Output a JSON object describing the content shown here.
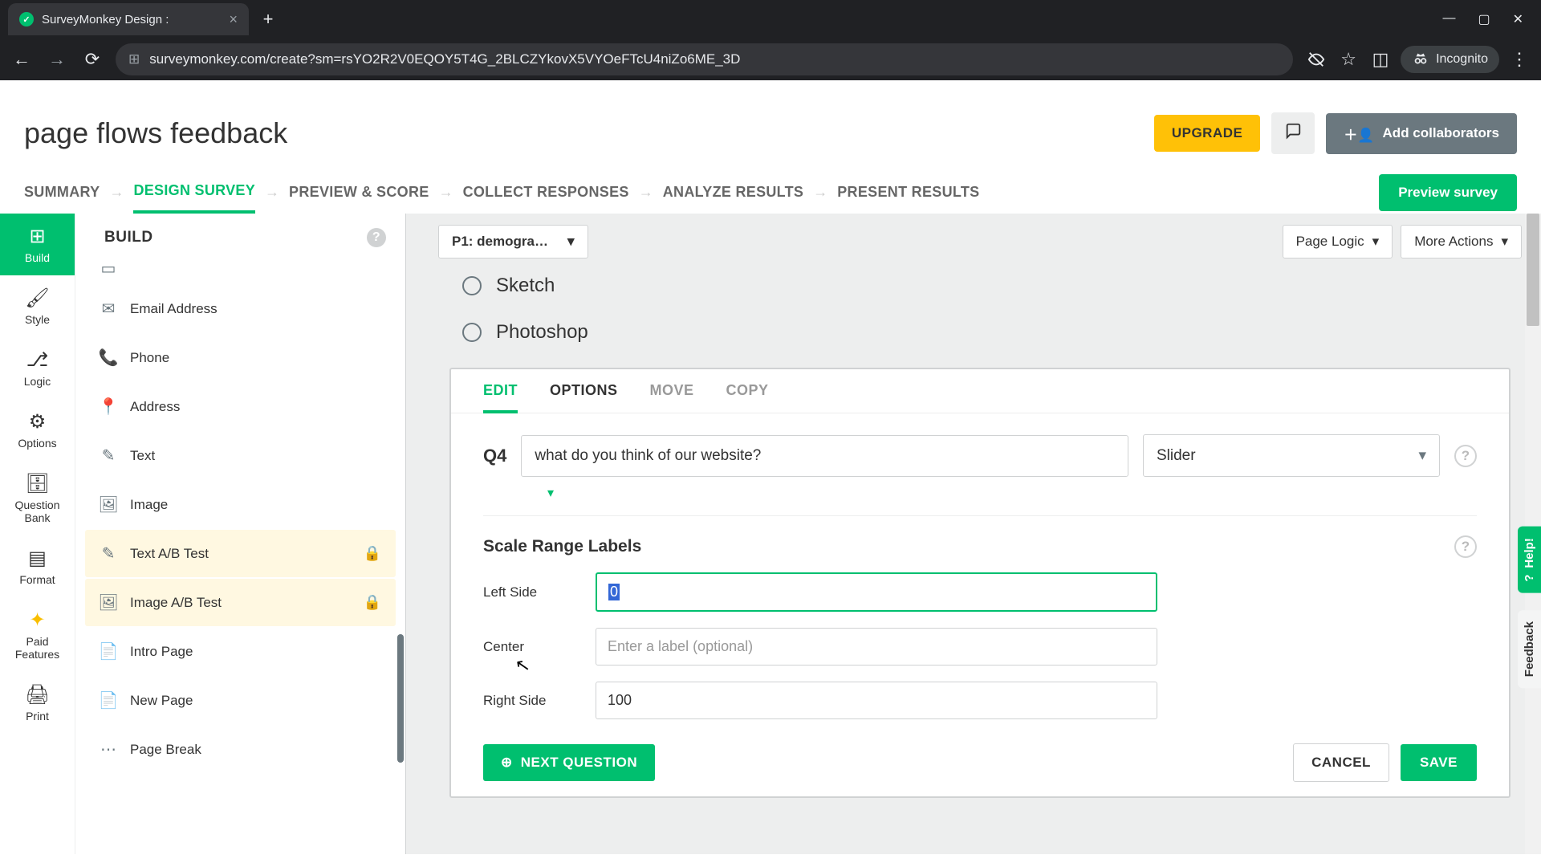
{
  "browser": {
    "tab_title": "SurveyMonkey Design :",
    "url": "surveymonkey.com/create?sm=rsYO2R2V0EQOY5T4G_2BLCZYkovX5VYOeFTcU4niZo6ME_3D",
    "incognito_label": "Incognito"
  },
  "header": {
    "survey_title": "page flows feedback",
    "upgrade": "UPGRADE",
    "add_collab": "Add collaborators"
  },
  "steps": {
    "summary": "SUMMARY",
    "design": "DESIGN SURVEY",
    "preview": "PREVIEW & SCORE",
    "collect": "COLLECT RESPONSES",
    "analyze": "ANALYZE RESULTS",
    "present": "PRESENT RESULTS",
    "preview_btn": "Preview survey"
  },
  "leftnav": {
    "build": "Build",
    "style": "Style",
    "logic": "Logic",
    "options": "Options",
    "qbank": "Question\nBank",
    "format": "Format",
    "paid": "Paid\nFeatures",
    "print": "Print"
  },
  "builder": {
    "head": "BUILD",
    "items": {
      "email": "Email Address",
      "phone": "Phone",
      "address": "Address",
      "text": "Text",
      "image": "Image",
      "text_ab": "Text A/B Test",
      "image_ab": "Image A/B Test",
      "intro": "Intro Page",
      "newpage": "New Page",
      "pagebreak": "Page Break"
    }
  },
  "canvas": {
    "page_selector": "P1: demograph...",
    "page_logic": "Page Logic",
    "more_actions": "More Actions",
    "radio_sketch": "Sketch",
    "radio_photoshop": "Photoshop"
  },
  "qeditor": {
    "tabs": {
      "edit": "EDIT",
      "options": "OPTIONS",
      "move": "MOVE",
      "copy": "COPY"
    },
    "qnum": "Q4",
    "qtext": "what do you think of our website?",
    "qtype": "Slider",
    "section_title": "Scale Range Labels",
    "left_label": "Left Side",
    "left_value": "0",
    "center_label": "Center",
    "center_placeholder": "Enter a label (optional)",
    "right_label": "Right Side",
    "right_value": "100",
    "next_question": "NEXT QUESTION",
    "cancel": "CANCEL",
    "save": "SAVE"
  },
  "float": {
    "help": "Help!",
    "feedback": "Feedback"
  }
}
